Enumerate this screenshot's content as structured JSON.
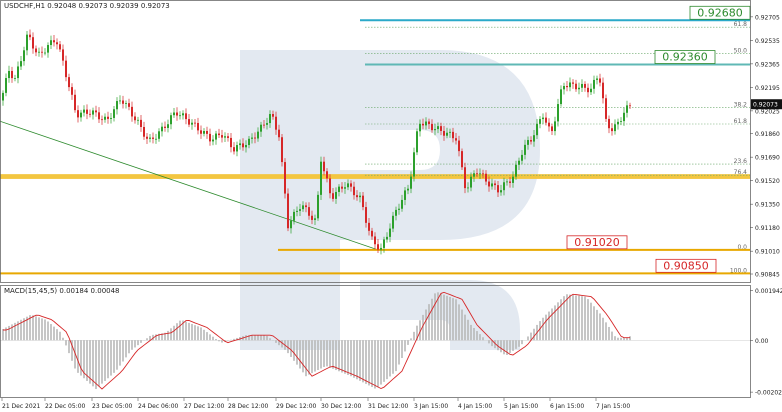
{
  "header": {
    "main_title": "USDCHF,H1  0.92048 0.92073 0.92039 0.92073",
    "macd_title": "MACD(15,45,5) 0.00184 0.00048"
  },
  "colors": {
    "bull": "#2ca02c",
    "bear": "#d62728",
    "fibo_teal": "#5fb8b5",
    "fibo_blue": "#2aa9c9",
    "gold": "#e8a800",
    "macd_line": "#d62728",
    "macd_hist": "#b8b8b8",
    "trend_line": "#2e8b2e",
    "watermark": "#dfe6ef"
  },
  "chart_data": [
    {
      "type": "candlestick",
      "symbol": "USDCHF",
      "timeframe": "H1",
      "ylim": [
        0.9078,
        0.9274
      ],
      "y_ticks": [
        "0.92705",
        "0.92535",
        "0.92365",
        "0.92195",
        "0.92025",
        "0.91860",
        "0.91690",
        "0.91520",
        "0.91350",
        "0.91180",
        "0.91010",
        "0.90845"
      ],
      "x_ticks": [
        "21 Dec 2021",
        "22 Dec 05:00",
        "23 Dec 05:00",
        "24 Dec 06:00",
        "27 Dec 12:00",
        "28 Dec 12:00",
        "29 Dec 12:00",
        "30 Dec 12:00",
        "31 Dec 12:00",
        "3 Jan 15:00",
        "4 Jan 15:00",
        "5 Jan 15:00",
        "6 Jan 15:00",
        "7 Jan 15:00"
      ],
      "path": [
        [
          0.921,
          0
        ],
        [
          0.9232,
          8
        ],
        [
          0.9225,
          14
        ],
        [
          0.9258,
          27
        ],
        [
          0.9242,
          37
        ],
        [
          0.9255,
          55
        ],
        [
          0.9235,
          63
        ],
        [
          0.92,
          75
        ],
        [
          0.9202,
          90
        ],
        [
          0.9195,
          106
        ],
        [
          0.9212,
          120
        ],
        [
          0.9195,
          136
        ],
        [
          0.918,
          148
        ],
        [
          0.9188,
          160
        ],
        [
          0.9202,
          175
        ],
        [
          0.9195,
          188
        ],
        [
          0.9182,
          210
        ],
        [
          0.9186,
          222
        ],
        [
          0.9175,
          232
        ],
        [
          0.918,
          248
        ],
        [
          0.919,
          260
        ],
        [
          0.92,
          270
        ],
        [
          0.9185,
          278
        ],
        [
          0.912,
          287
        ],
        [
          0.9135,
          300
        ],
        [
          0.9122,
          315
        ],
        [
          0.9168,
          320
        ],
        [
          0.914,
          330
        ],
        [
          0.915,
          345
        ],
        [
          0.9138,
          360
        ],
        [
          0.911,
          370
        ],
        [
          0.9102,
          380
        ],
        [
          0.913,
          395
        ],
        [
          0.9148,
          408
        ],
        [
          0.9195,
          418
        ],
        [
          0.9188,
          440
        ],
        [
          0.9183,
          455
        ],
        [
          0.9145,
          465
        ],
        [
          0.916,
          475
        ],
        [
          0.915,
          488
        ],
        [
          0.9145,
          498
        ],
        [
          0.9155,
          512
        ],
        [
          0.9175,
          522
        ],
        [
          0.9182,
          530
        ],
        [
          0.92,
          542
        ],
        [
          0.9185,
          550
        ],
        [
          0.9222,
          562
        ],
        [
          0.922,
          578
        ],
        [
          0.9218,
          590
        ],
        [
          0.923,
          598
        ],
        [
          0.9195,
          605
        ],
        [
          0.9188,
          612
        ],
        [
          0.92,
          622
        ],
        [
          0.9208,
          630
        ]
      ],
      "fibo_levels": [
        {
          "label": "61.8",
          "price": 0.9263,
          "x_start": 365
        },
        {
          "label": "50.0",
          "price": 0.9244,
          "x_start": 365
        },
        {
          "label": "38.2",
          "price": 0.9205,
          "x_start": 365
        },
        {
          "label": "61.8",
          "price": 0.9193,
          "x_start": 365
        },
        {
          "label": "23.6",
          "price": 0.9164,
          "x_start": 365
        },
        {
          "label": "76.4",
          "price": 0.9156,
          "x_start": 365
        },
        {
          "label": "0.0",
          "price": 0.9102,
          "x_start": 278
        },
        {
          "label": "100.0",
          "price": 0.9085,
          "x_start": 0
        }
      ],
      "key_levels": [
        {
          "label": "0.92680",
          "price": 0.9268,
          "color": "#2aa9c9",
          "text_color": "#2e8b2e"
        },
        {
          "label": "0.92360",
          "price": 0.9236,
          "color": "#5fb8b5",
          "text_color": "#2e8b2e"
        },
        {
          "label": "0.91020",
          "price": 0.9102,
          "color": "#e8a800",
          "text_color": "#d62728"
        },
        {
          "label": "0.90850",
          "price": 0.9085,
          "color": "#e8a800",
          "text_color": "#d62728"
        }
      ],
      "support_band": [
        0.9154,
        0.9156
      ],
      "current_price": "0.92073"
    },
    {
      "type": "macd",
      "params": "MACD(15,45,5)",
      "y_ticks": [
        "0.001942",
        "0.00",
        "-0.002021"
      ],
      "ylim": [
        -0.00225,
        0.002
      ],
      "histogram_path": [
        [
          0.0004,
          0
        ],
        [
          0.001,
          30
        ],
        [
          0.0008,
          45
        ],
        [
          0.0003,
          60
        ],
        [
          -0.0012,
          75
        ],
        [
          -0.0019,
          95
        ],
        [
          -0.0012,
          115
        ],
        [
          -0.0004,
          130
        ],
        [
          0.0002,
          150
        ],
        [
          0.0003,
          165
        ],
        [
          0.0008,
          180
        ],
        [
          0.0005,
          200
        ],
        [
          -0.0001,
          220
        ],
        [
          0.0002,
          245
        ],
        [
          0.0002,
          265
        ],
        [
          -0.0004,
          285
        ],
        [
          -0.0014,
          305
        ],
        [
          -0.001,
          325
        ],
        [
          -0.0014,
          350
        ],
        [
          -0.0019,
          375
        ],
        [
          -0.0012,
          395
        ],
        [
          0.0005,
          415
        ],
        [
          0.0019,
          435
        ],
        [
          0.0016,
          455
        ],
        [
          0.0006,
          470
        ],
        [
          -0.0002,
          490
        ],
        [
          -0.0006,
          505
        ],
        [
          -0.0002,
          520
        ],
        [
          0.0008,
          540
        ],
        [
          0.0018,
          565
        ],
        [
          0.0017,
          585
        ],
        [
          0.001,
          600
        ],
        [
          0.0001,
          615
        ],
        [
          0.0001,
          625
        ],
        [
          0.0002,
          632
        ]
      ]
    }
  ]
}
